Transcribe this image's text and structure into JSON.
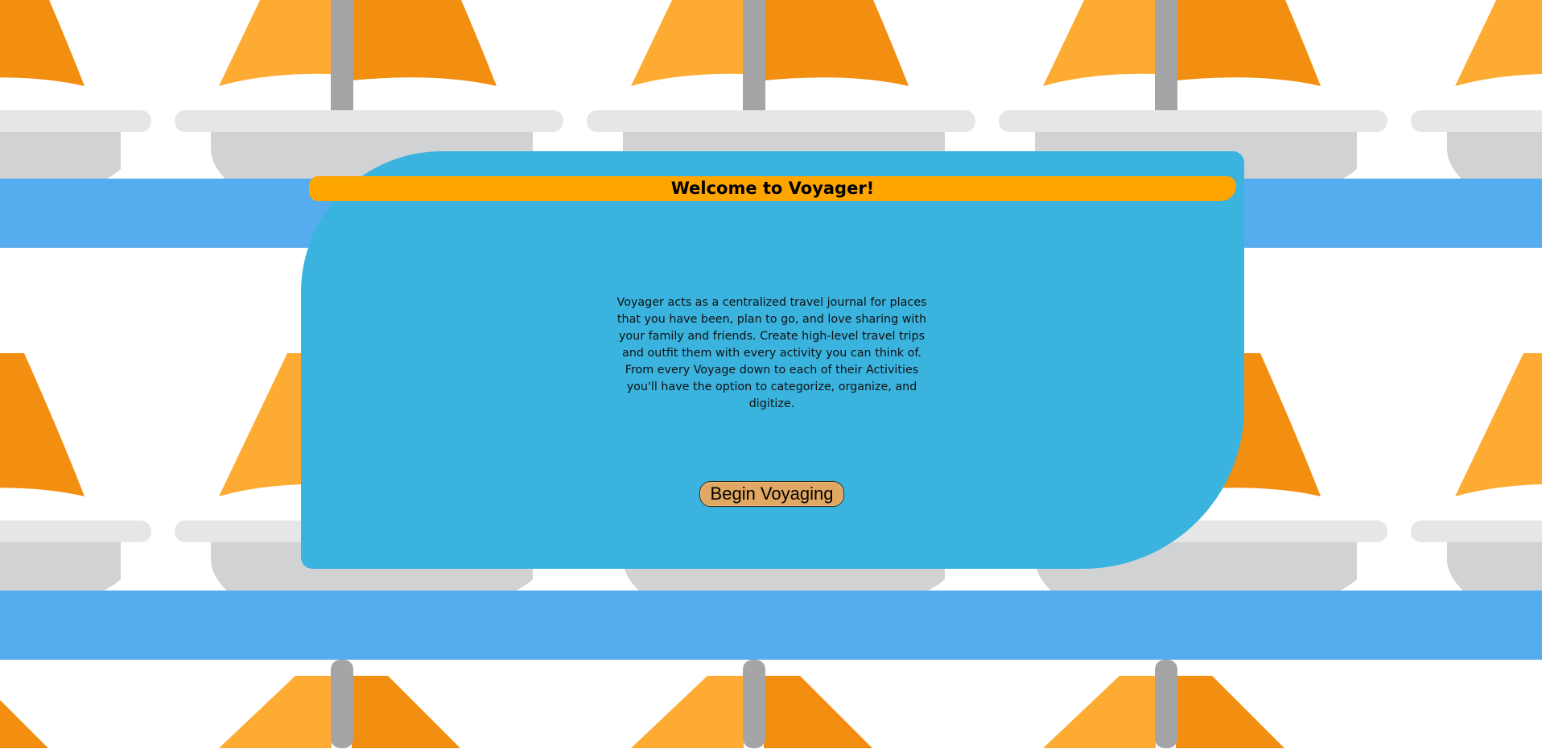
{
  "welcome": {
    "title": "Welcome to Voyager!",
    "description": "Voyager acts as a centralized travel journal for places that you have been, plan to go, and love sharing with your family and friends. Create high-level travel trips and outfit them with every activity you can think of. From every Voyage down to each of their Activities you'll have the option to categorize, organize, and digitize.",
    "button_label": "Begin Voyaging"
  },
  "colors": {
    "card": "#3ab3df",
    "title_bar": "#ffa500",
    "button": "#e0a862",
    "sail_light": "#fdab32",
    "sail_dark": "#f28e10",
    "mast": "#a5a5a8",
    "hull": "#d1d2d4",
    "deck": "#e5e6e8",
    "water": "#55acee"
  },
  "background": {
    "pattern": "sailboat-icon"
  }
}
